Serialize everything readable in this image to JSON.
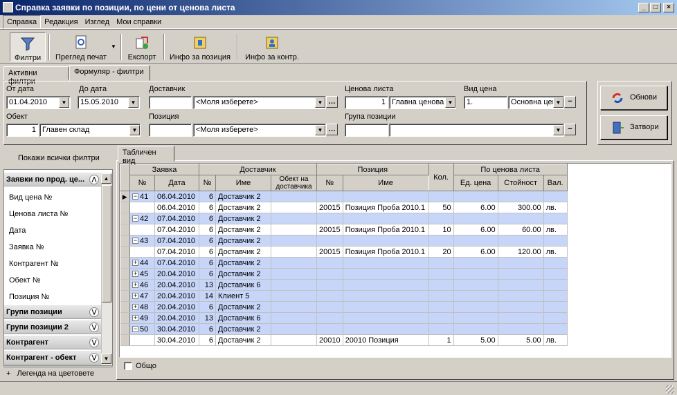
{
  "window": {
    "title": "Справка заявки по позиции, по цени от ценова листа"
  },
  "menu": [
    "Справка",
    "Редакция",
    "Изглед",
    "Мои справки"
  ],
  "toolbar": {
    "filters": "Филтри",
    "print_preview": "Преглед печат",
    "export": "Експорт",
    "item_info": "Инфо за позиция",
    "contractor_info": "Инфо за контр."
  },
  "filter_tabs": [
    "Активни филтри",
    "Формуляр - филтри"
  ],
  "form": {
    "from_date_label": "От дата",
    "from_date": "01.04.2010",
    "to_date_label": "До дата",
    "to_date": "15.05.2010",
    "supplier_label": "Доставчик",
    "supplier_code": "",
    "supplier_value": "<Моля изберете>",
    "price_list_label": "Ценова листа",
    "price_list_code": "1",
    "price_list_value": "Главна ценова",
    "price_type_label": "Вид цена",
    "price_type_code": "1.",
    "price_type_value": "Основна цена",
    "object_label": "Обект",
    "object_code": "1",
    "object_value": "Главен склад",
    "item_label": "Позиция",
    "item_code": "",
    "item_value": "<Моля изберете>",
    "item_group_label": "Група позиции",
    "item_group_code": "",
    "item_group_value": ""
  },
  "buttons": {
    "refresh": "Обнови",
    "close": "Затвори"
  },
  "left_panel": {
    "show_all": "Покажи всички филтри",
    "section_open": "Заявки по прод. це...",
    "items": [
      "Вид цена №",
      "Ценова листа №",
      "Дата",
      "Заявка №",
      "Контрагент №",
      "Обект №",
      "Позиция №"
    ],
    "sections": [
      "Групи позиции",
      "Групи позиции 2",
      "Контрагент",
      "Контрагент - обект"
    ],
    "legend": "Легенда на цветовете"
  },
  "grid_tab": "Табличен вид",
  "grid": {
    "head_top": [
      "Заявка",
      "Доставчик",
      "Позиция",
      "Кол.",
      "По ценова листа"
    ],
    "head_sub": [
      "№",
      "Дата",
      "№",
      "Име",
      "Обект на доставчика",
      "№",
      "Име",
      "Ед. цена",
      "Стойност",
      "Вал."
    ],
    "rows": [
      {
        "t": "g",
        "sel": true,
        "exp": "−",
        "no": "41",
        "date": "06.04.2010",
        "sno": "6",
        "sname": "Доставчик 2"
      },
      {
        "t": "d",
        "date": "06.04.2010",
        "sno": "6",
        "sname": "Доставчик 2",
        "pno": "20015",
        "pname": "Позиция Проба 2010.1",
        "qty": "50",
        "price": "6.00",
        "total": "300.00",
        "cur": "лв."
      },
      {
        "t": "g",
        "exp": "−",
        "no": "42",
        "date": "07.04.2010",
        "sno": "6",
        "sname": "Доставчик 2"
      },
      {
        "t": "d",
        "date": "07.04.2010",
        "sno": "6",
        "sname": "Доставчик 2",
        "pno": "20015",
        "pname": "Позиция Проба 2010.1",
        "qty": "10",
        "price": "6.00",
        "total": "60.00",
        "cur": "лв."
      },
      {
        "t": "g",
        "exp": "−",
        "no": "43",
        "date": "07.04.2010",
        "sno": "6",
        "sname": "Доставчик 2"
      },
      {
        "t": "d",
        "date": "07.04.2010",
        "sno": "6",
        "sname": "Доставчик 2",
        "pno": "20015",
        "pname": "Позиция Проба 2010.1",
        "qty": "20",
        "price": "6.00",
        "total": "120.00",
        "cur": "лв."
      },
      {
        "t": "g",
        "exp": "+",
        "no": "44",
        "date": "07.04.2010",
        "sno": "6",
        "sname": "Доставчик 2"
      },
      {
        "t": "g",
        "exp": "+",
        "no": "45",
        "date": "20.04.2010",
        "sno": "6",
        "sname": "Доставчик 2"
      },
      {
        "t": "g",
        "exp": "+",
        "no": "46",
        "date": "20.04.2010",
        "sno": "13",
        "sname": "Доставчик 6"
      },
      {
        "t": "g",
        "exp": "+",
        "no": "47",
        "date": "20.04.2010",
        "sno": "14",
        "sname": "Клиент 5"
      },
      {
        "t": "g",
        "exp": "+",
        "no": "48",
        "date": "20.04.2010",
        "sno": "6",
        "sname": "Доставчик 2"
      },
      {
        "t": "g",
        "exp": "+",
        "no": "49",
        "date": "20.04.2010",
        "sno": "13",
        "sname": "Доставчик 6"
      },
      {
        "t": "g",
        "exp": "−",
        "no": "50",
        "date": "30.04.2010",
        "sno": "6",
        "sname": "Доставчик 2"
      },
      {
        "t": "d",
        "date": "30.04.2010",
        "sno": "6",
        "sname": "Доставчик 2",
        "pno": "20010",
        "pname": "20010 Позиция",
        "qty": "1",
        "price": "5.00",
        "total": "5.00",
        "cur": "лв."
      }
    ]
  },
  "footer": {
    "total_label": "Общо"
  },
  "colors": {
    "group_row": "#c6d5f8",
    "title_start": "#0a246a",
    "title_end": "#a6caf0"
  }
}
